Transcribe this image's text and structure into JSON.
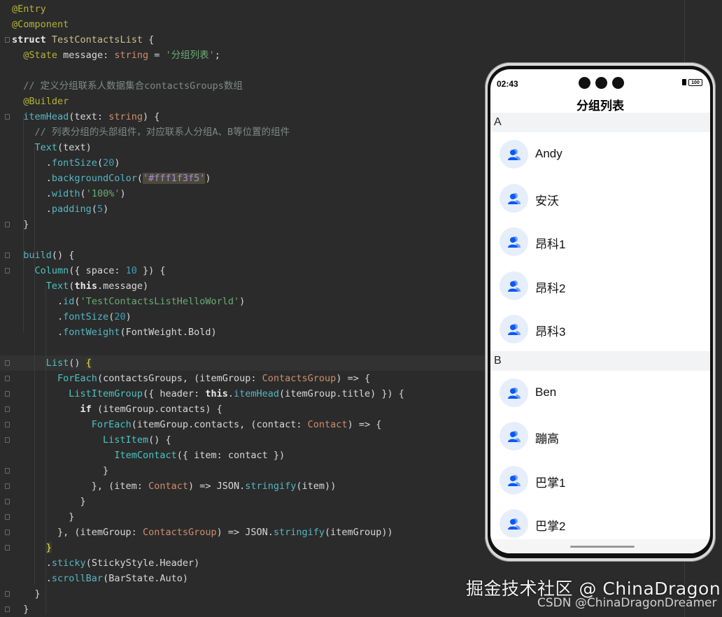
{
  "editor": {
    "lines": [
      [
        [
          "ann",
          "@Entry"
        ]
      ],
      [
        [
          "ann",
          "@Component"
        ]
      ],
      [
        [
          "kw",
          "struct "
        ],
        [
          "gen",
          "TestContactsList"
        ],
        [
          "id",
          " {"
        ]
      ],
      [
        [
          "id",
          "  "
        ],
        [
          "ann",
          "@State"
        ],
        [
          "id",
          " message: "
        ],
        [
          "param",
          "string"
        ],
        [
          "id",
          " = "
        ],
        [
          "str",
          "'分组列表'"
        ],
        [
          "id",
          ";"
        ]
      ],
      [
        [
          "id",
          ""
        ]
      ],
      [
        [
          "com",
          "  // 定义分组联系人数据集合contactsGroups数组"
        ]
      ],
      [
        [
          "id",
          "  "
        ],
        [
          "ann",
          "@Builder"
        ]
      ],
      [
        [
          "id",
          "  "
        ],
        [
          "method",
          "itemHead"
        ],
        [
          "id",
          "(text: "
        ],
        [
          "param",
          "string"
        ],
        [
          "id",
          ") {"
        ]
      ],
      [
        [
          "com",
          "    // 列表分组的头部组件，对应联系人分组A、B等位置的组件"
        ]
      ],
      [
        [
          "id",
          "    "
        ],
        [
          "type",
          "Text"
        ],
        [
          "id",
          "(text)"
        ]
      ],
      [
        [
          "id",
          "      ."
        ],
        [
          "method",
          "fontSize"
        ],
        [
          "id",
          "("
        ],
        [
          "num",
          "20"
        ],
        [
          "id",
          ")"
        ]
      ],
      [
        [
          "id",
          "      ."
        ],
        [
          "method",
          "backgroundColor"
        ],
        [
          "id",
          "("
        ],
        [
          "strhl",
          "'#fff1f3f5'"
        ],
        [
          "id",
          ")"
        ]
      ],
      [
        [
          "id",
          "      ."
        ],
        [
          "method",
          "width"
        ],
        [
          "id",
          "("
        ],
        [
          "str",
          "'100%'"
        ],
        [
          "id",
          ")"
        ]
      ],
      [
        [
          "id",
          "      ."
        ],
        [
          "method",
          "padding"
        ],
        [
          "id",
          "("
        ],
        [
          "num",
          "5"
        ],
        [
          "id",
          ")"
        ]
      ],
      [
        [
          "id",
          "  }"
        ]
      ],
      [
        [
          "id",
          ""
        ]
      ],
      [
        [
          "id",
          "  "
        ],
        [
          "method",
          "build"
        ],
        [
          "id",
          "() {"
        ]
      ],
      [
        [
          "id",
          "    "
        ],
        [
          "type",
          "Column"
        ],
        [
          "id",
          "({ space: "
        ],
        [
          "num",
          "10"
        ],
        [
          "id",
          " }) {"
        ]
      ],
      [
        [
          "id",
          "      "
        ],
        [
          "type",
          "Text"
        ],
        [
          "id",
          "("
        ],
        [
          "kw",
          "this"
        ],
        [
          "id",
          ".message)"
        ]
      ],
      [
        [
          "id",
          "        ."
        ],
        [
          "method",
          "id"
        ],
        [
          "id",
          "("
        ],
        [
          "str",
          "'TestContactsListHelloWorld'"
        ],
        [
          "id",
          ")"
        ]
      ],
      [
        [
          "id",
          "        ."
        ],
        [
          "method",
          "fontSize"
        ],
        [
          "id",
          "("
        ],
        [
          "num",
          "20"
        ],
        [
          "id",
          ")"
        ]
      ],
      [
        [
          "id",
          "        ."
        ],
        [
          "method",
          "fontWeight"
        ],
        [
          "id",
          "(FontWeight.Bold)"
        ]
      ],
      [
        [
          "id",
          ""
        ]
      ],
      [
        [
          "id",
          "      "
        ],
        [
          "type",
          "List"
        ],
        [
          "id",
          "() "
        ],
        [
          "brack",
          "{"
        ]
      ],
      [
        [
          "id",
          "        "
        ],
        [
          "type",
          "ForEach"
        ],
        [
          "id",
          "(contactsGroups, (itemGroup: "
        ],
        [
          "param",
          "ContactsGroup"
        ],
        [
          "id",
          ") => {"
        ]
      ],
      [
        [
          "id",
          "          "
        ],
        [
          "type",
          "ListItemGroup"
        ],
        [
          "id",
          "({ header: "
        ],
        [
          "kw",
          "this"
        ],
        [
          "id",
          "."
        ],
        [
          "method",
          "itemHead"
        ],
        [
          "id",
          "(itemGroup.title) }) {"
        ]
      ],
      [
        [
          "id",
          "            "
        ],
        [
          "kw",
          "if"
        ],
        [
          "id",
          " (itemGroup.contacts) {"
        ]
      ],
      [
        [
          "id",
          "              "
        ],
        [
          "type",
          "ForEach"
        ],
        [
          "id",
          "(itemGroup.contacts, (contact: "
        ],
        [
          "param",
          "Contact"
        ],
        [
          "id",
          ") => {"
        ]
      ],
      [
        [
          "id",
          "                "
        ],
        [
          "type",
          "ListItem"
        ],
        [
          "id",
          "() {"
        ]
      ],
      [
        [
          "id",
          "                  "
        ],
        [
          "type",
          "ItemContact"
        ],
        [
          "id",
          "({ item: contact })"
        ]
      ],
      [
        [
          "id",
          "                }"
        ]
      ],
      [
        [
          "id",
          "              }, (item: "
        ],
        [
          "param",
          "Contact"
        ],
        [
          "id",
          ") => JSON."
        ],
        [
          "method",
          "stringify"
        ],
        [
          "id",
          "(item))"
        ]
      ],
      [
        [
          "id",
          "            }"
        ]
      ],
      [
        [
          "id",
          "          }"
        ]
      ],
      [
        [
          "id",
          "        }, (itemGroup: "
        ],
        [
          "param",
          "ContactsGroup"
        ],
        [
          "id",
          ") => JSON."
        ],
        [
          "method",
          "stringify"
        ],
        [
          "id",
          "(itemGroup))"
        ]
      ],
      [
        [
          "id",
          "      "
        ],
        [
          "brack",
          "}"
        ]
      ],
      [
        [
          "id",
          "      ."
        ],
        [
          "method",
          "sticky"
        ],
        [
          "id",
          "(StickyStyle.Header)"
        ]
      ],
      [
        [
          "id",
          "      ."
        ],
        [
          "method",
          "scrollBar"
        ],
        [
          "id",
          "(BarState.Auto)"
        ]
      ],
      [
        [
          "id",
          "    }"
        ]
      ],
      [
        [
          "id",
          "  }"
        ]
      ]
    ],
    "fold_lines": [
      2,
      7,
      14,
      16,
      17,
      23,
      24,
      25,
      26,
      27,
      28,
      30,
      31,
      32,
      33,
      34,
      35,
      38,
      39
    ]
  },
  "phone": {
    "status_time": "02:43",
    "battery_label": "100",
    "title": "分组列表",
    "groups": [
      {
        "title": "A",
        "contacts": [
          "Andy",
          "安沃",
          "昂科1",
          "昂科2",
          "昂科3"
        ]
      },
      {
        "title": "B",
        "contacts": [
          "Ben",
          "蹦高",
          "巴掌1",
          "巴掌2"
        ]
      }
    ],
    "accent_color": "#0a59f7"
  },
  "watermark": {
    "main": "掘金技术社区 @ ChinaDragon",
    "sub": "CSDN @ChinaDragonDreamer"
  }
}
